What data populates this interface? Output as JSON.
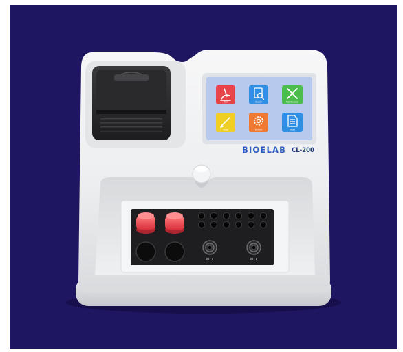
{
  "device": {
    "brand": "BIOELAB",
    "model": "CL-200",
    "brand_color": "#2d5ec2",
    "model_color": "#1e3a78"
  },
  "screen": {
    "background": "#b7c9ec",
    "apps": [
      {
        "label": "Test",
        "icon": "microscope-icon",
        "color": "#e9434a"
      },
      {
        "label": "Search",
        "icon": "magnifier-document-icon",
        "color": "#2f8fe2"
      },
      {
        "label": "Maintenance",
        "icon": "tools-icon",
        "color": "#4cbd4c"
      },
      {
        "label": "Setup",
        "icon": "pencil-icon",
        "color": "#eecf25"
      },
      {
        "label": "System",
        "icon": "gear-icon",
        "color": "#f07a32"
      },
      {
        "label": "About",
        "icon": "document-icon",
        "color": "#2f8fe2"
      }
    ]
  },
  "ports": {
    "channels": [
      "CH-1",
      "CH-2"
    ]
  }
}
